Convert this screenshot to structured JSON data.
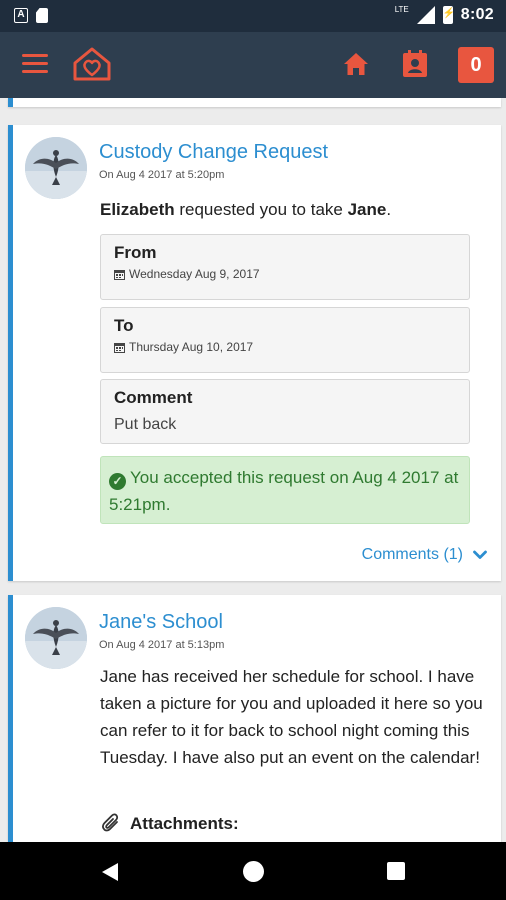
{
  "status_bar": {
    "network": "LTE",
    "time": "8:02"
  },
  "app_bar": {
    "notification_count": "0"
  },
  "colors": {
    "accent": "#e8563f",
    "link": "#2c8ed0",
    "header": "#2e3e4f",
    "success_bg": "#d6efd2",
    "success_text": "#2f7a30"
  },
  "feed": [
    {
      "title": "Custody Change Request",
      "date": "On Aug 4 2017 at 5:20pm",
      "requester": "Elizabeth",
      "request_middle": " requested you to take ",
      "child": "Jane",
      "request_end": ".",
      "from_label": "From",
      "from_value": "Wednesday Aug 9, 2017",
      "to_label": "To",
      "to_value": "Thursday Aug 10, 2017",
      "comment_label": "Comment",
      "comment_value": "Put back",
      "accepted_text": "You accepted this request on Aug 4 2017 at 5:21pm.",
      "comments_link": "Comments (1)"
    },
    {
      "title": "Jane's School",
      "date": "On Aug 4 2017 at 5:13pm",
      "body": "Jane has received her schedule for school. I have taken a picture for you and uploaded it here so you can refer to it for back to school night coming this Tuesday. I have also put an event on the calendar!",
      "attachments_label": "Attachments:"
    }
  ]
}
